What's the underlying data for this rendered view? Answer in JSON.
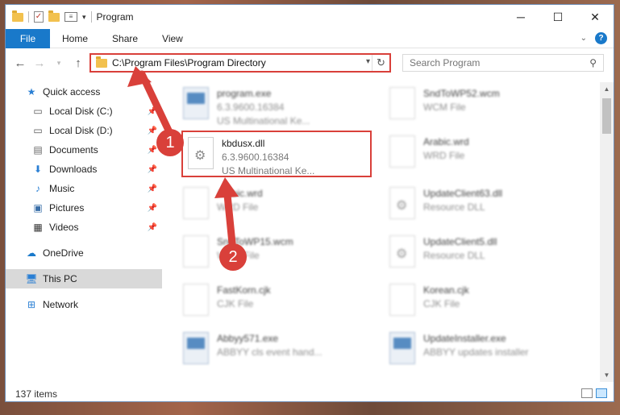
{
  "window": {
    "title": "Program",
    "controls": {
      "minimize": "─",
      "maximize": "☐",
      "close": "✕"
    }
  },
  "ribbon": {
    "tabs": [
      "File",
      "Home",
      "Share",
      "View"
    ],
    "help": "?"
  },
  "nav": {
    "address": "C:\\Program Files\\Program Directory",
    "search_placeholder": "Search Program"
  },
  "sidebar": {
    "quick_access": "Quick access",
    "items": [
      {
        "label": "Local Disk (C:)",
        "icon": "drive-icon",
        "pinned": true
      },
      {
        "label": "Local Disk (D:)",
        "icon": "drive-icon",
        "pinned": true
      },
      {
        "label": "Documents",
        "icon": "documents-icon",
        "pinned": true
      },
      {
        "label": "Downloads",
        "icon": "download-icon",
        "pinned": true
      },
      {
        "label": "Music",
        "icon": "music-icon",
        "pinned": true
      },
      {
        "label": "Pictures",
        "icon": "pictures-icon",
        "pinned": true
      },
      {
        "label": "Videos",
        "icon": "videos-icon",
        "pinned": true
      }
    ],
    "onedrive": "OneDrive",
    "this_pc": "This PC",
    "network": "Network"
  },
  "files": {
    "left": [
      {
        "name": "program.exe",
        "line2": "6.3.9600.16384",
        "line3": "US Multinational Ke..."
      },
      {
        "name": "kbdusx.dll",
        "line2": "6.3.9600.16384",
        "line3": "US Multinational Ke..."
      },
      {
        "name": "Arabic.wrd",
        "line2": "WRD File",
        "line3": ""
      },
      {
        "name": "SndToWP15.wcm",
        "line2": "WCM File",
        "line3": ""
      },
      {
        "name": "FastKorn.cjk",
        "line2": "CJK File",
        "line3": ""
      },
      {
        "name": "Abbyy571.exe",
        "line2": "ABBYY cls event hand...",
        "line3": ""
      }
    ],
    "right": [
      {
        "name": "SndToWP52.wcm",
        "line2": "WCM File"
      },
      {
        "name": "Arabic.wrd",
        "line2": "WRD File"
      },
      {
        "name": "UpdateClient63.dll",
        "line2": "Resource DLL"
      },
      {
        "name": "UpdateClient5.dll",
        "line2": "Resource DLL"
      },
      {
        "name": "Korean.cjk",
        "line2": "CJK File"
      },
      {
        "name": "UpdateInstaller.exe",
        "line2": "ABBYY updates installer"
      }
    ]
  },
  "status": {
    "items": "137 items"
  },
  "callouts": [
    "1",
    "2"
  ],
  "colors": {
    "accent": "#1979ca",
    "highlight": "#d9403a"
  }
}
